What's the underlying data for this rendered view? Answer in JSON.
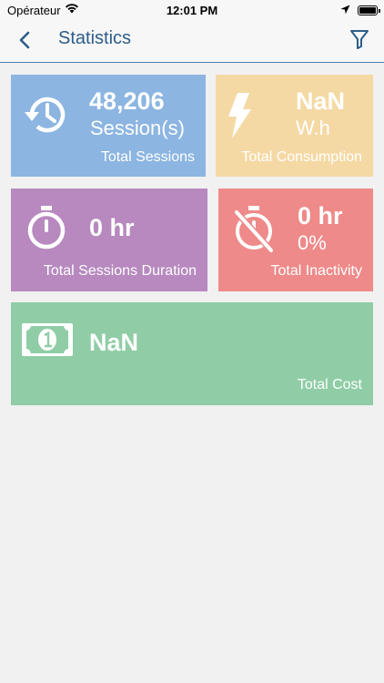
{
  "status_bar": {
    "carrier": "Opérateur",
    "time": "12:01 PM"
  },
  "nav": {
    "title": "Statistics"
  },
  "tiles": {
    "sessions": {
      "value": "48,206",
      "unit": "Session(s)",
      "label": "Total Sessions",
      "color": "#8cb5e1",
      "icon": "history-icon"
    },
    "consumption": {
      "value": "NaN",
      "unit": "W.h",
      "label": "Total Consumption",
      "color": "#f5d9a4",
      "icon": "lightning-icon"
    },
    "duration": {
      "value": "0 hr",
      "label": "Total Sessions Duration",
      "color": "#b789bf",
      "icon": "stopwatch-icon"
    },
    "inactivity": {
      "value": "0 hr",
      "unit": "0%",
      "label": "Total Inactivity",
      "color": "#ee8a89",
      "icon": "stopwatch-off-icon"
    },
    "cost": {
      "value": "NaN",
      "label": "Total Cost",
      "color": "#90cda6",
      "icon": "money-bill-icon"
    }
  }
}
